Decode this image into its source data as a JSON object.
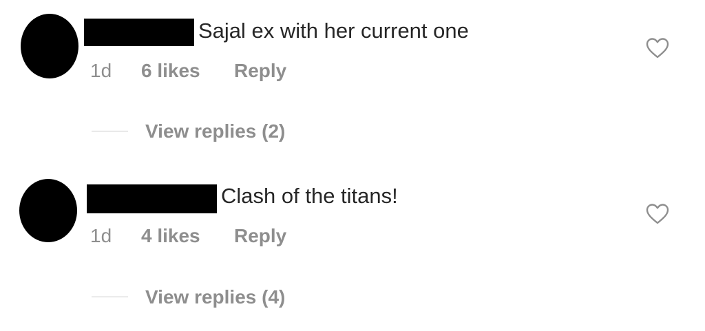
{
  "comments": [
    {
      "text": "Sajal ex with her current one",
      "time": "1d",
      "likes": "6 likes",
      "reply_label": "Reply",
      "view_replies": "View replies (2)",
      "like_icon": "heart-outline-icon"
    },
    {
      "text": "Clash of the titans!",
      "time": "1d",
      "likes": "4 likes",
      "reply_label": "Reply",
      "view_replies": "View replies (4)",
      "like_icon": "heart-outline-icon"
    }
  ],
  "colors": {
    "text_primary": "#262626",
    "text_secondary": "#8e8e8e",
    "divider": "#c7c7c7",
    "redaction": "#000000"
  }
}
